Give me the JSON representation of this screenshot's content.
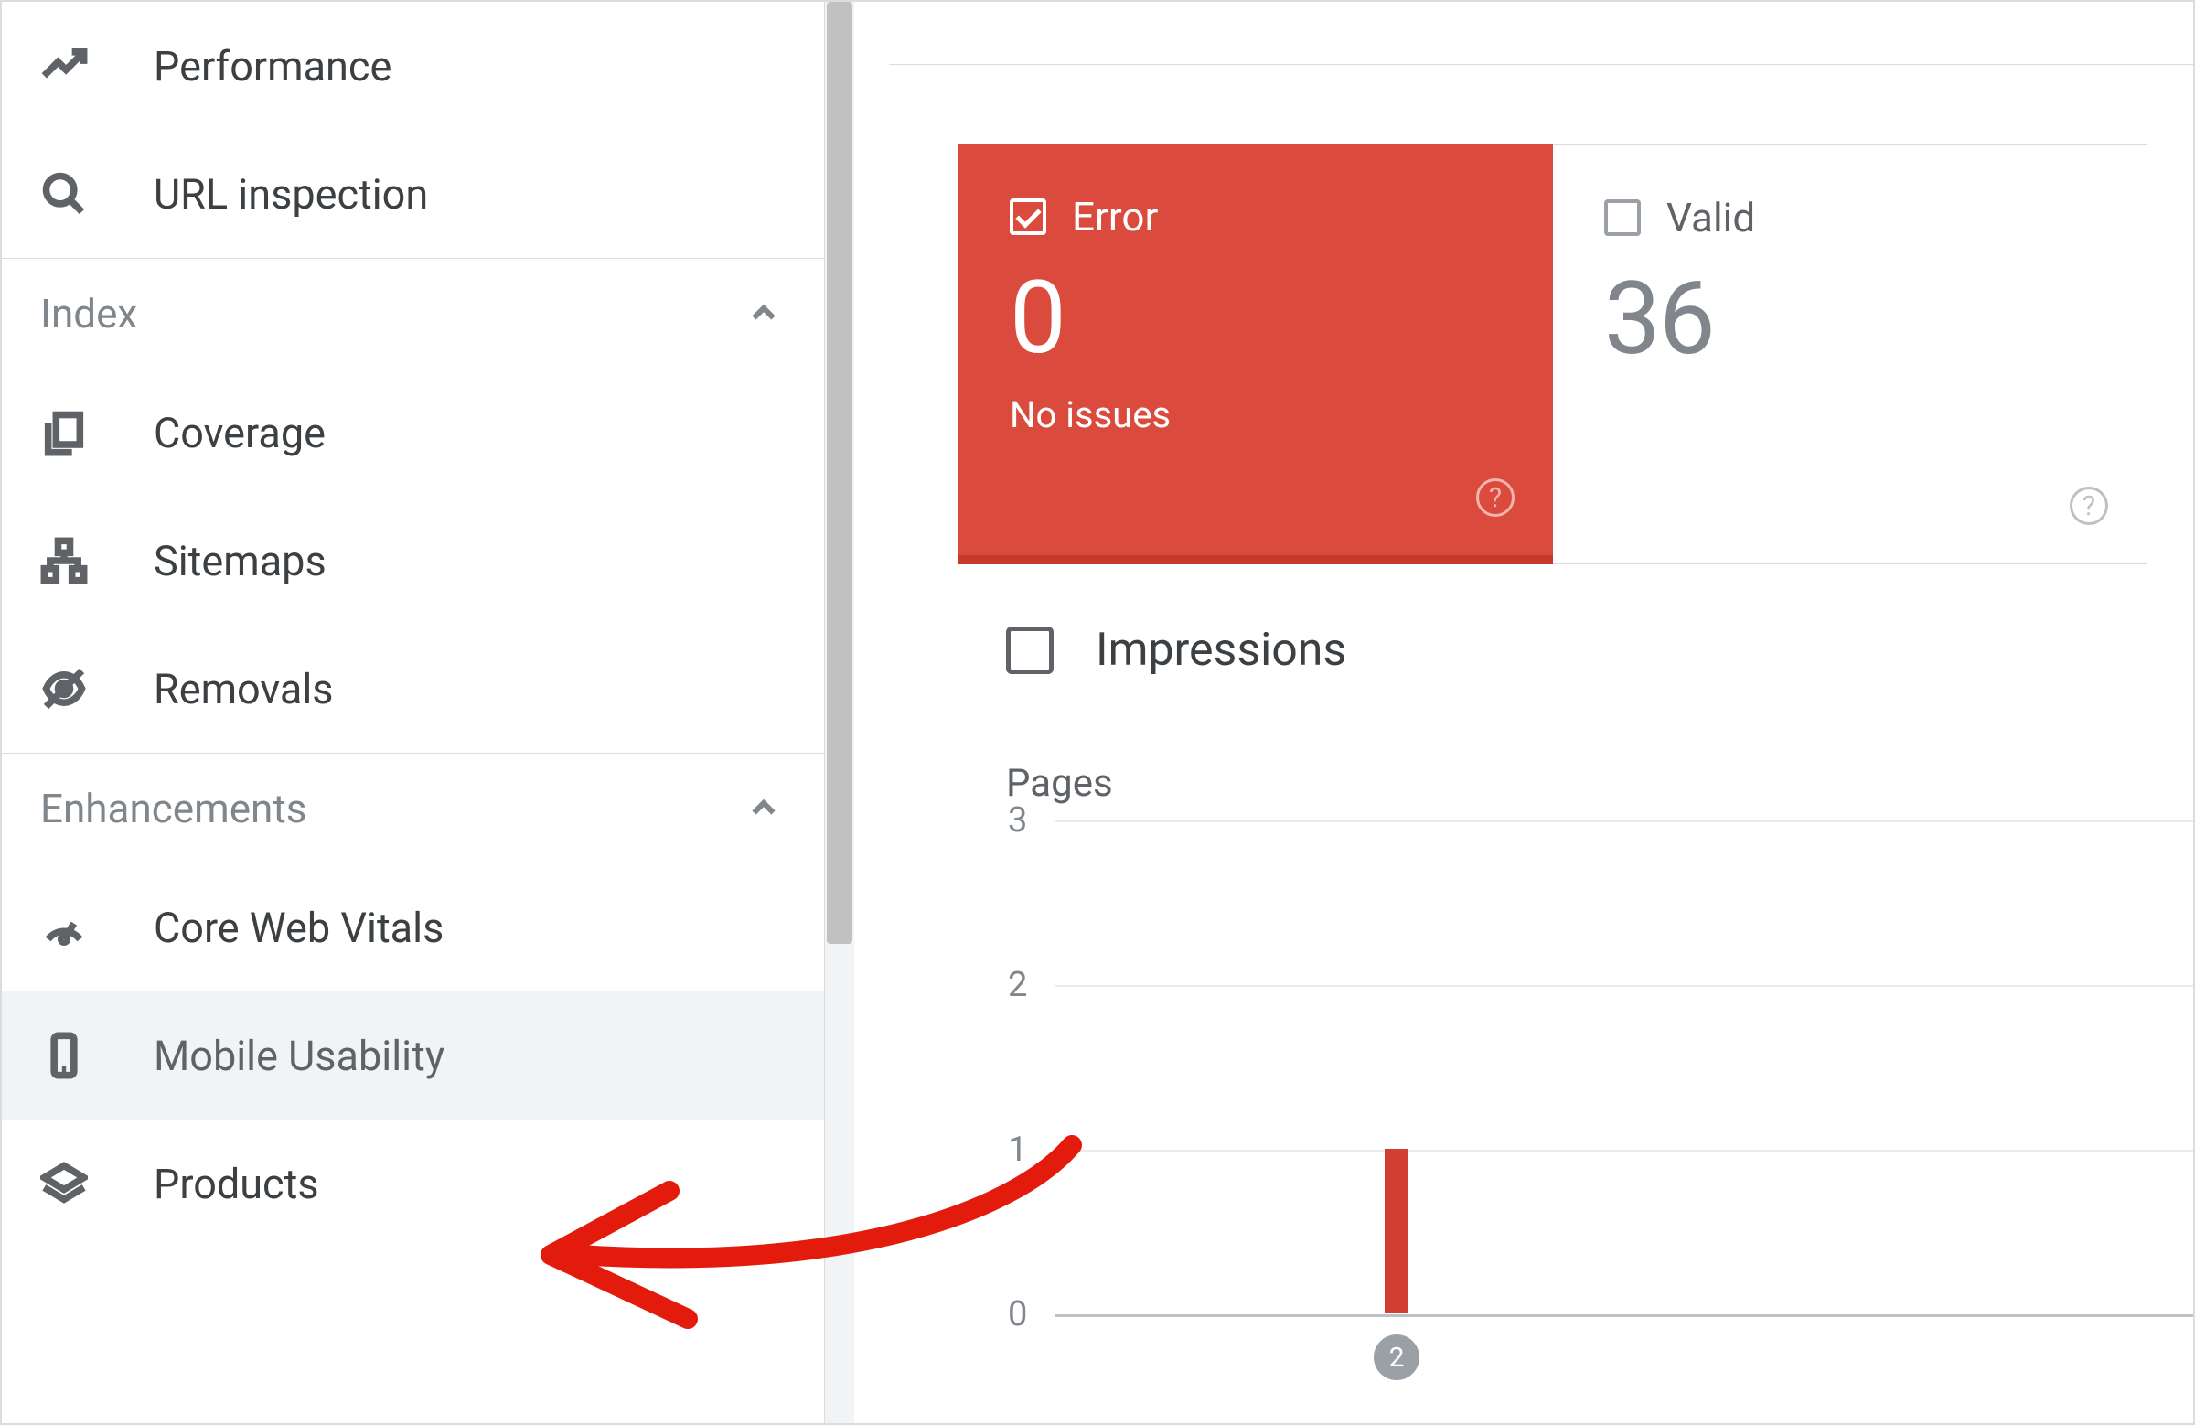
{
  "sidebar": {
    "top_items": [
      {
        "id": "performance",
        "label": "Performance"
      },
      {
        "id": "url-inspection",
        "label": "URL inspection"
      }
    ],
    "sections": [
      {
        "title": "Index",
        "items": [
          {
            "id": "coverage",
            "label": "Coverage"
          },
          {
            "id": "sitemaps",
            "label": "Sitemaps"
          },
          {
            "id": "removals",
            "label": "Removals"
          }
        ]
      },
      {
        "title": "Enhancements",
        "items": [
          {
            "id": "core-web-vitals",
            "label": "Core Web Vitals"
          },
          {
            "id": "mobile-usability",
            "label": "Mobile Usability",
            "selected": true
          },
          {
            "id": "products",
            "label": "Products"
          }
        ]
      }
    ]
  },
  "cards": {
    "error": {
      "label": "Error",
      "count": "0",
      "subtext": "No issues",
      "checked": true
    },
    "valid": {
      "label": "Valid",
      "count": "36",
      "checked": false
    }
  },
  "impressions": {
    "label": "Impressions",
    "checked": false
  },
  "chart_title": "Pages",
  "chart_data": {
    "type": "bar",
    "ylabel": "Pages",
    "ylim": [
      0,
      3
    ],
    "yticks": [
      0,
      1,
      2,
      3
    ],
    "categories": [
      "2"
    ],
    "series": [
      {
        "name": "Error",
        "color": "#d23f31",
        "values": [
          1
        ]
      }
    ]
  },
  "annotation": {
    "points_to": "mobile-usability"
  }
}
